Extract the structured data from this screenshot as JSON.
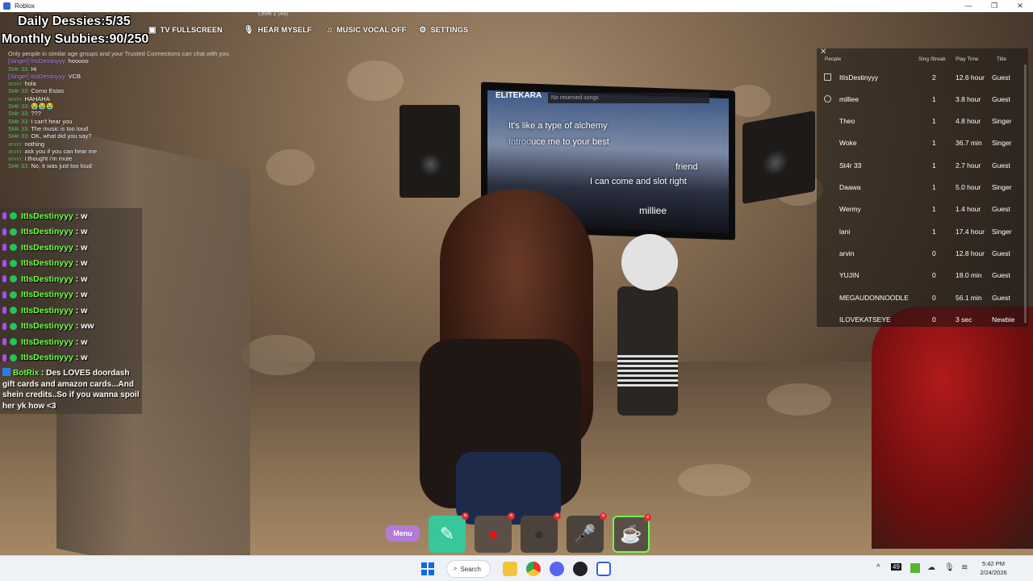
{
  "window": {
    "title": "Roblox",
    "controls": [
      "—",
      "❐",
      "✕"
    ]
  },
  "hud": {
    "daily": "Daily Dessies:5/35",
    "monthly": "Monthly Subbies:90/250",
    "level": "Level 2 (49)",
    "buttons": [
      {
        "label": "TV FULLSCREEN",
        "icon": "tv-icon"
      },
      {
        "label": "HEAR MYSELF",
        "icon": "mic-icon"
      },
      {
        "label": "MUSIC VOCAL OFF",
        "icon": "music-icon"
      },
      {
        "label": "SETTINGS",
        "icon": "gear-icon"
      }
    ]
  },
  "roblox_chat": {
    "system": "Only people in similar age groups and your Trusted Connections can chat with you.",
    "messages": [
      {
        "name": "[Singer] ItIsDestinyyy:",
        "text": "hooooo",
        "color": "sing"
      },
      {
        "name": "St4r 33:",
        "text": "Hi",
        "color": "star"
      },
      {
        "name": "[Singer] ItIsDestinyyy:",
        "text": "VCB",
        "color": "sing"
      },
      {
        "name": "arvin:",
        "text": "hola",
        "color": "arvin"
      },
      {
        "name": "St4r 33:",
        "text": "Como Estas",
        "color": "star"
      },
      {
        "name": "arvin:",
        "text": "HAHAHA",
        "color": "arvin"
      },
      {
        "name": "St4r 33:",
        "text": "😭😭😭",
        "color": "star"
      },
      {
        "name": "St4r 33:",
        "text": "???",
        "color": "star"
      },
      {
        "name": "St4r 33:",
        "text": "I can't hear you",
        "color": "star"
      },
      {
        "name": "St4r 33:",
        "text": "The music is too loud",
        "color": "star"
      },
      {
        "name": "St4r 33:",
        "text": "OK, what did you say?",
        "color": "star"
      },
      {
        "name": "arvin:",
        "text": "nothing",
        "color": "arvin"
      },
      {
        "name": "arvin:",
        "text": "ask you if you can hear me",
        "color": "arvin"
      },
      {
        "name": "arvin:",
        "text": "i thought i'm mute",
        "color": "arvin"
      },
      {
        "name": "St4r 33:",
        "text": "No, it was just too loud",
        "color": "star"
      }
    ]
  },
  "stream_chat": {
    "rows": [
      {
        "user": "ItIsDestinyyy",
        "msg": ": w"
      },
      {
        "user": "ItIsDestinyyy",
        "msg": ": w"
      },
      {
        "user": "ItIsDestinyyy",
        "msg": ": w"
      },
      {
        "user": "ItIsDestinyyy",
        "msg": ": w"
      },
      {
        "user": "ItIsDestinyyy",
        "msg": ": w"
      },
      {
        "user": "ItIsDestinyyy",
        "msg": ": w"
      },
      {
        "user": "ItIsDestinyyy",
        "msg": ": w"
      },
      {
        "user": "ItIsDestinyyy",
        "msg": ": ww"
      },
      {
        "user": "ItIsDestinyyy",
        "msg": ": w"
      },
      {
        "user": "ItIsDestinyyy",
        "msg": ": w"
      }
    ],
    "bot": {
      "user": "BotRix",
      "msg": ": Des LOVES doordash gift cards and amazon cards...And shein credits..So if you wanna spoil her yk how <3"
    }
  },
  "karaoke": {
    "brand": "ELITEKARA",
    "queue": "No reserved songs",
    "line1": "It's like a type of alchemy",
    "line2_sung": "Introd",
    "line2_rest": "uce me to your best",
    "line3": "friend",
    "line4": "I can come and slot right",
    "singer": "milliee"
  },
  "leaderboard": {
    "headers": {
      "people": "People",
      "streak": "Sing Streak",
      "play": "Play Time",
      "title": "Title"
    },
    "rows": [
      {
        "name": "ItIsDestinyyy",
        "streak": "2",
        "time": "12.6 hour",
        "title": "Guest"
      },
      {
        "name": "milliee",
        "streak": "1",
        "time": "3.8 hour",
        "title": "Guest"
      },
      {
        "name": "Theo",
        "streak": "1",
        "time": "4.8 hour",
        "title": "Singer"
      },
      {
        "name": "Woke",
        "streak": "1",
        "time": "36.7 min",
        "title": "Singer"
      },
      {
        "name": "St4r 33",
        "streak": "1",
        "time": "2.7 hour",
        "title": "Guest"
      },
      {
        "name": "Daawa",
        "streak": "1",
        "time": "5.0 hour",
        "title": "Singer"
      },
      {
        "name": "Wermy",
        "streak": "1",
        "time": "1.4 hour",
        "title": "Guest"
      },
      {
        "name": "lani",
        "streak": "1",
        "time": "17.4 hour",
        "title": "Singer"
      },
      {
        "name": "arvin",
        "streak": "0",
        "time": "12.8 hour",
        "title": "Guest"
      },
      {
        "name": "YUJIN",
        "streak": "0",
        "time": "18.0 min",
        "title": "Guest"
      },
      {
        "name": "MEGAUDONNOODLE",
        "streak": "0",
        "time": "56.1 min",
        "title": "Guest"
      },
      {
        "name": "ILOVEKATSEYE",
        "streak": "0",
        "time": "3 sec",
        "title": "Newbie"
      }
    ]
  },
  "hotbar": {
    "menu": "Menu"
  },
  "taskbar": {
    "search": "Search",
    "time": "5:42 PM",
    "date": "2/24/2026"
  }
}
